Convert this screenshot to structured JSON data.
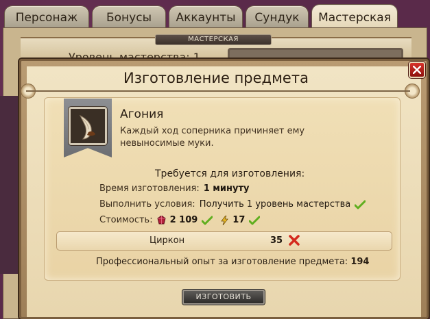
{
  "tabs": [
    {
      "label": "Персонаж"
    },
    {
      "label": "Бонусы"
    },
    {
      "label": "Аккаунты"
    },
    {
      "label": "Сундук"
    },
    {
      "label": "Мастерская"
    }
  ],
  "background_window": {
    "title": "МАСТЕРСКАЯ",
    "mastery_line": "Уровень мастерства: 1"
  },
  "dialog": {
    "title": "Изготовление предмета",
    "close_icon": "close-x"
  },
  "item": {
    "name": "Агония",
    "description": "Каждый ход соперника причиняет ему невыносимые муки.",
    "icon": "horn-icon"
  },
  "requirements": {
    "header": "Требуется для изготовления:",
    "time_label": "Время изготовления:",
    "time_value": "1 минуту",
    "conditions_label": "Выполнить условия:",
    "conditions_value": "Получить 1 уровень мастерства",
    "cost_label": "Стоимость:",
    "cost_crystals": "2 109",
    "cost_energy": "17"
  },
  "resource": {
    "name": "Циркон",
    "value": "35",
    "status": "missing"
  },
  "experience": {
    "label": "Профессиональный опыт за изготовление предмета:",
    "value": "194"
  },
  "craft_button": "ИЗГОТОВИТЬ",
  "colors": {
    "ok": "#5fae1e",
    "missing": "#d42a1e",
    "close": "#c3231c"
  }
}
